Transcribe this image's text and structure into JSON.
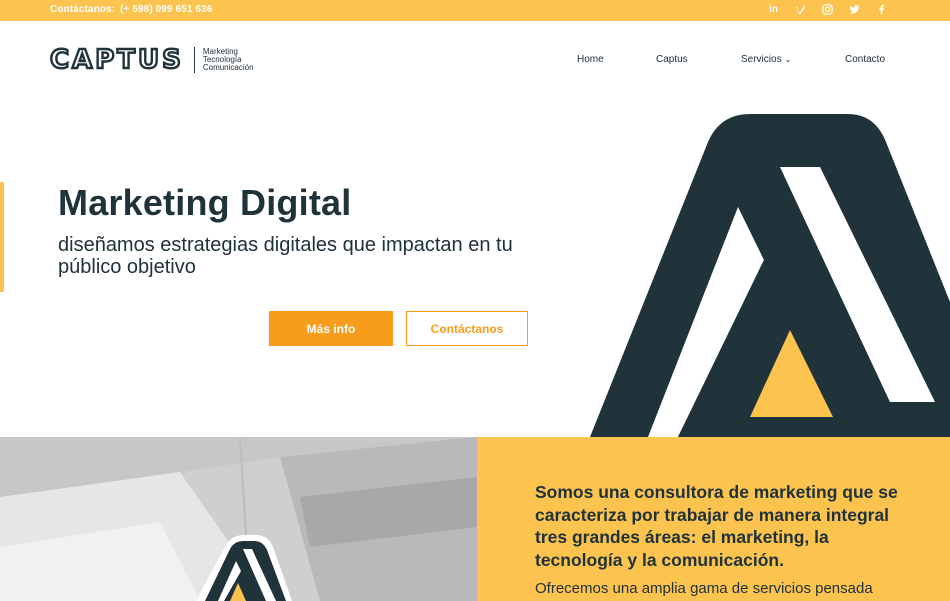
{
  "topbar": {
    "contact_label": "Contáctanos:",
    "phone": "(+ 598) 099 651 636",
    "social": [
      "linkedin-icon",
      "vimeo-icon",
      "instagram-icon",
      "twitter-icon",
      "facebook-icon"
    ]
  },
  "header": {
    "logo_text": "CAPTUS",
    "tagline": [
      "Marketing",
      "Tecnología",
      "Comunicación"
    ],
    "nav": [
      "Home",
      "Captus",
      "Servicios",
      "Contacto"
    ]
  },
  "hero": {
    "title": "Marketing Digital",
    "subtitle": "diseñamos estrategias digitales que impactan en tu público objetivo",
    "primary_button": "Más info",
    "secondary_button": "Contáctanos"
  },
  "about": {
    "title": "Somos una consultora de marketing que se caracteriza por trabajar de manera integral tres grandes áreas: el marketing, la tecnología y la comunicación.",
    "text": "Ofrecemos una amplia gama de servicios pensada"
  },
  "colors": {
    "brand_dark": "#20323a",
    "brand_yellow": "#fcc34f",
    "brand_orange": "#f89c1c"
  }
}
